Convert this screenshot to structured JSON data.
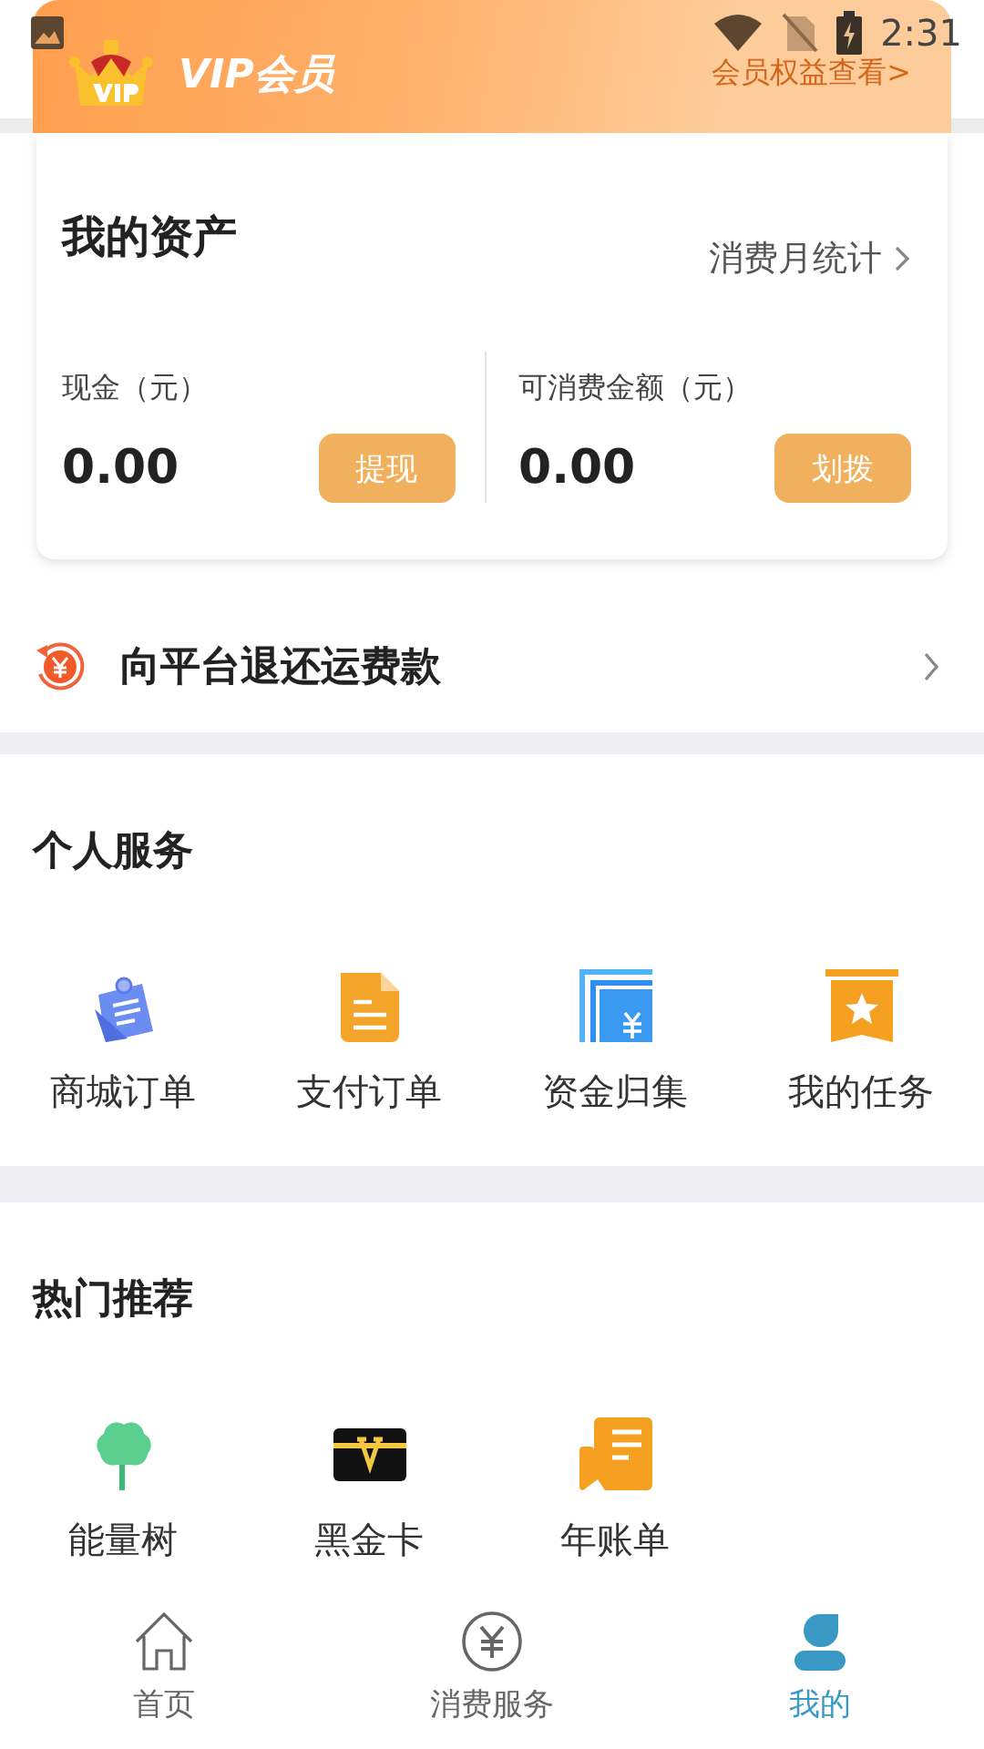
{
  "status_bar": {
    "time": "2:31"
  },
  "vip_banner": {
    "title": "VIP会员",
    "link": "会员权益查看>"
  },
  "assets": {
    "title": "我的资产",
    "stats_link": "消费月统计",
    "balances": [
      {
        "label": "现金（元）",
        "amount": "0.00",
        "button": "提现"
      },
      {
        "label": "可消费金额（元）",
        "amount": "0.00",
        "button": "划拨"
      }
    ]
  },
  "refund_row": {
    "label": "向平台退还运费款"
  },
  "sections": [
    {
      "title": "个人服务",
      "items": [
        {
          "label": "商城订单",
          "kind": "memo"
        },
        {
          "label": "支付订单",
          "kind": "doc"
        },
        {
          "label": "资金归集",
          "kind": "fund"
        },
        {
          "label": "我的任务",
          "kind": "task"
        }
      ]
    },
    {
      "title": "热门推荐",
      "items": [
        {
          "label": "能量树",
          "kind": "tree"
        },
        {
          "label": "黑金卡",
          "kind": "card"
        },
        {
          "label": "年账单",
          "kind": "bill"
        }
      ]
    }
  ],
  "tab_bar": [
    {
      "label": "首页",
      "kind": "home",
      "selected": false
    },
    {
      "label": "消费服务",
      "kind": "yuan",
      "selected": false
    },
    {
      "label": "我的",
      "kind": "user",
      "selected": true
    }
  ]
}
